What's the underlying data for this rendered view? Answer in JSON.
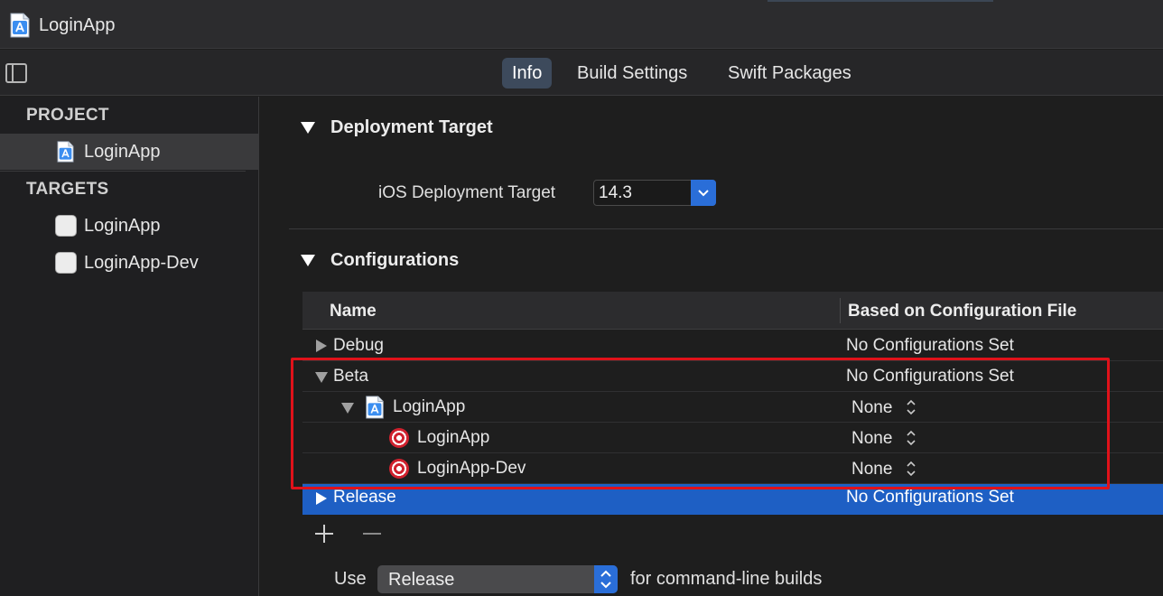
{
  "window": {
    "title": "LoginApp"
  },
  "toolbar": {
    "tabs": [
      {
        "label": "Info",
        "active": true
      },
      {
        "label": "Build Settings",
        "active": false
      },
      {
        "label": "Swift Packages",
        "active": false
      }
    ]
  },
  "sidebar": {
    "project_header": "PROJECT",
    "project_item": "LoginApp",
    "targets_header": "TARGETS",
    "targets": [
      "LoginApp",
      "LoginApp-Dev"
    ]
  },
  "deployment": {
    "title": "Deployment Target",
    "field_label": "iOS Deployment Target",
    "value": "14.3"
  },
  "configurations": {
    "title": "Configurations",
    "columns": {
      "name": "Name",
      "file": "Based on Configuration File"
    },
    "rows": [
      {
        "name": "Debug",
        "file": "No Configurations Set",
        "expanded": false
      },
      {
        "name": "Beta",
        "file": "No Configurations Set",
        "expanded": true,
        "project": {
          "name": "LoginApp",
          "file": "None"
        },
        "targets": [
          {
            "name": "LoginApp",
            "file": "None"
          },
          {
            "name": "LoginApp-Dev",
            "file": "None"
          }
        ]
      },
      {
        "name": "Release",
        "file": "No Configurations Set",
        "expanded": false,
        "selected": true
      }
    ],
    "use_label": "Use",
    "use_value": "Release",
    "use_suffix": "for command-line builds"
  },
  "colors": {
    "accent": "#2a6ed8",
    "selection": "#1e5fc4",
    "highlight": "#e0121a"
  }
}
